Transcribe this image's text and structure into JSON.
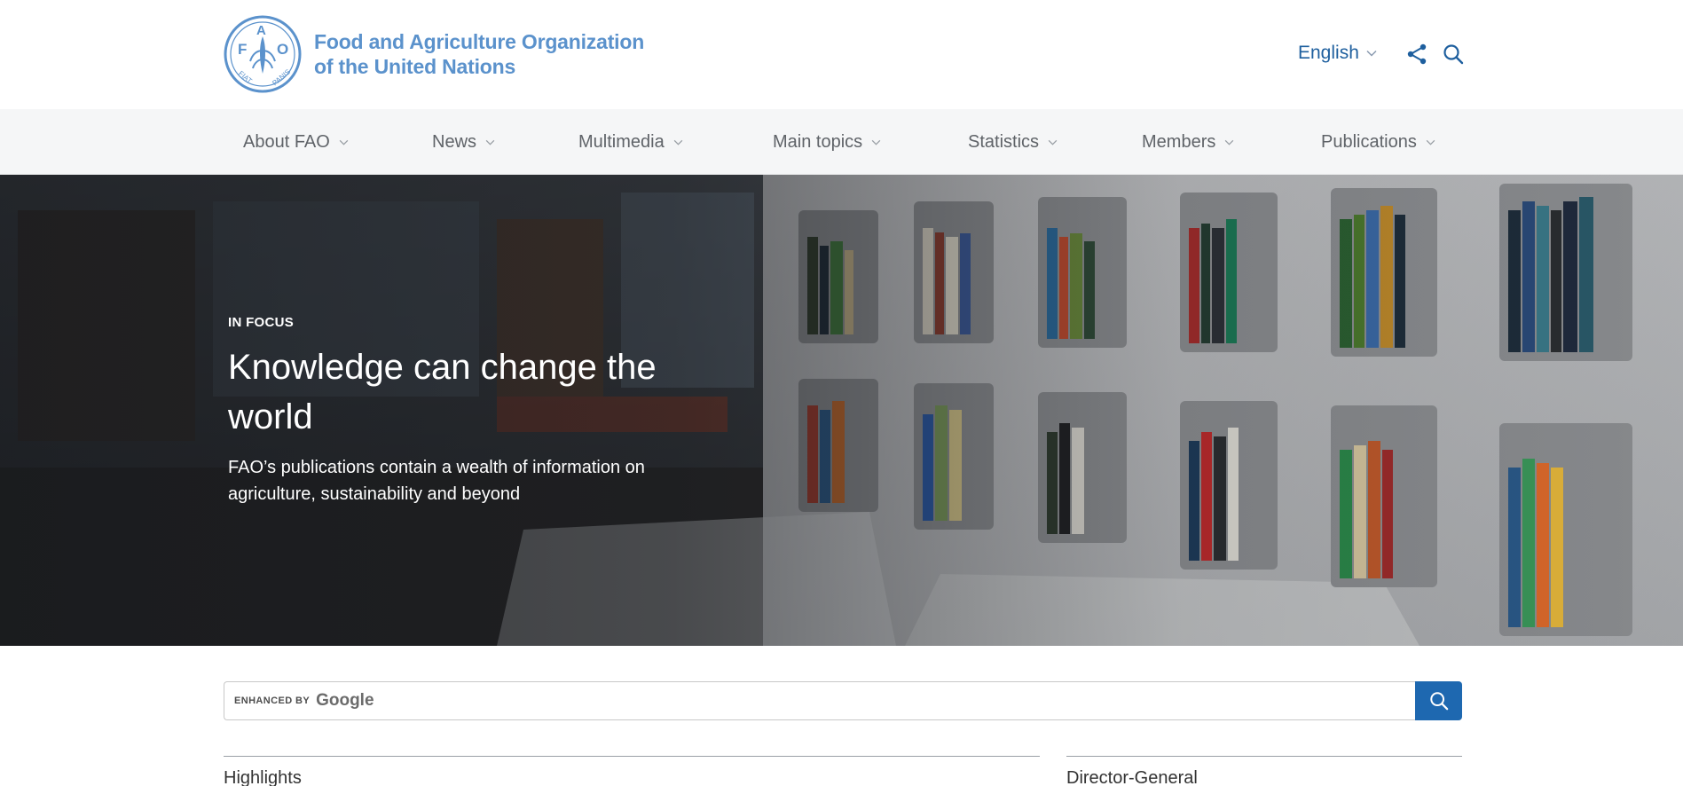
{
  "header": {
    "logo_emblem_letters": "FAO",
    "logo_motto": "FIAT PANIS",
    "org_name_line1": "Food and Agriculture Organization",
    "org_name_line2": "of the United Nations",
    "language": "English"
  },
  "nav": {
    "items": [
      {
        "label": "About FAO"
      },
      {
        "label": "News"
      },
      {
        "label": "Multimedia"
      },
      {
        "label": "Main topics"
      },
      {
        "label": "Statistics"
      },
      {
        "label": "Members"
      },
      {
        "label": "Publications"
      }
    ]
  },
  "hero": {
    "kicker": "IN FOCUS",
    "title": "Knowledge can change the world",
    "subtitle": "FAO’s publications contain a wealth of information on agriculture, sustainability and beyond"
  },
  "search": {
    "enhanced_by": "ENHANCED BY",
    "provider": "Google"
  },
  "sections": {
    "left_title": "Highlights",
    "right_title": "Director-General"
  },
  "colors": {
    "brand_blue": "#5b92cc",
    "link_blue": "#1e5f9e",
    "button_blue": "#1e68b0",
    "nav_bg": "#f5f6f7"
  },
  "icons": {
    "share": "share-icon",
    "search": "search-icon",
    "chevron": "chevron-down-icon"
  }
}
